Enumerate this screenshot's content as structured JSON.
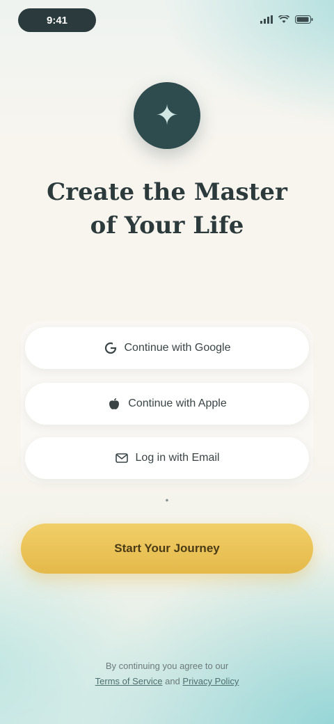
{
  "status_bar": {
    "time": "9:41",
    "signal_icon": "signal-icon",
    "wifi_icon": "wifi-icon",
    "battery_icon": "battery-icon"
  },
  "logo": {
    "icon": "app-logo-icon",
    "glyph": "✦"
  },
  "title": {
    "line1": "Create the Master",
    "line2": "of Your Life"
  },
  "auth": {
    "google_label": "Continue with Google",
    "apple_label": "Continue with Apple",
    "email_label": "Log in with Email"
  },
  "divider": {
    "glyph": "•"
  },
  "primary": {
    "label": "Start Your Journey"
  },
  "footer": {
    "line1": "By continuing you agree to our",
    "terms_label": "Terms of Service",
    "and_text": "and",
    "privacy_label": "Privacy Policy"
  },
  "colors": {
    "accent_gold": "#e4b94a",
    "logo_teal": "#2e4b4e",
    "background": "#f7f4ef"
  }
}
